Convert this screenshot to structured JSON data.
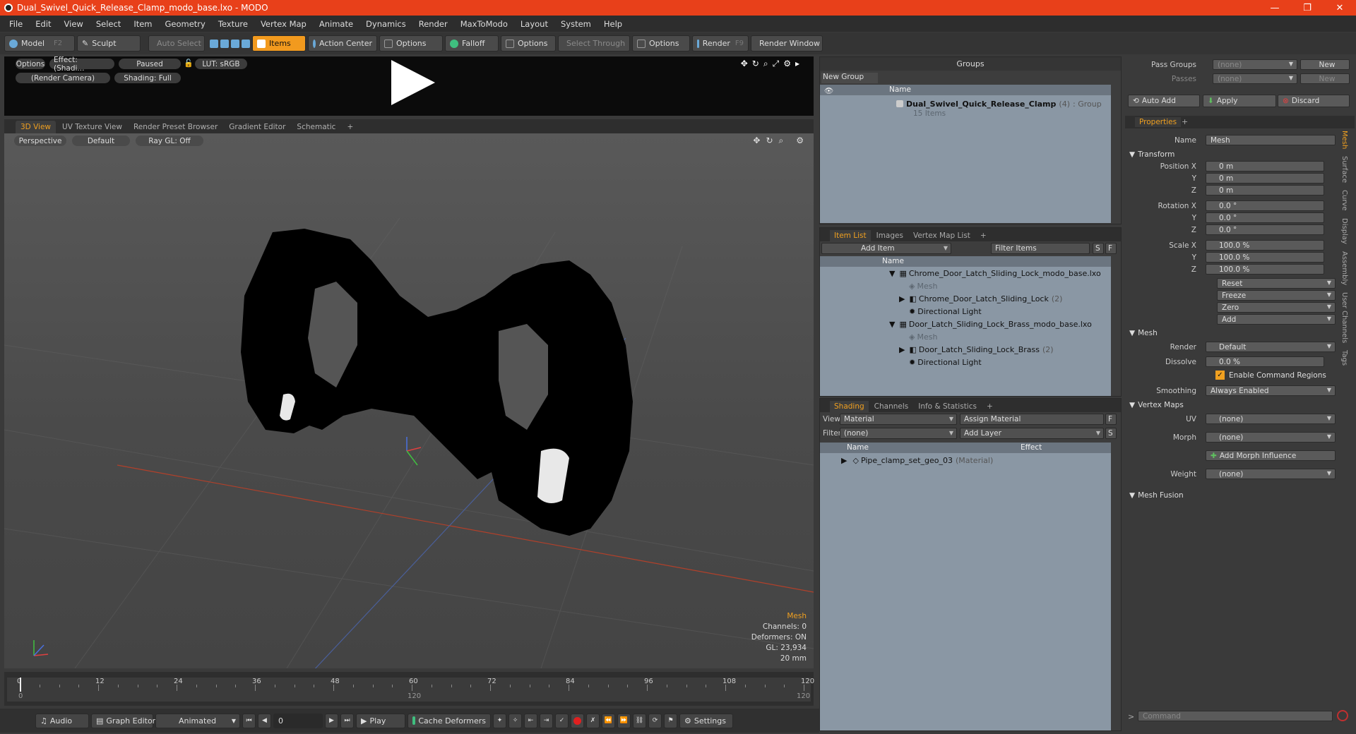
{
  "title": "Dual_Swivel_Quick_Release_Clamp_modo_base.lxo - MODO",
  "window_controls": {
    "minimize": "—",
    "restore": "❐",
    "close": "✕"
  },
  "menu": [
    "File",
    "Edit",
    "View",
    "Select",
    "Item",
    "Geometry",
    "Texture",
    "Vertex Map",
    "Animate",
    "Dynamics",
    "Render",
    "MaxToModo",
    "Layout",
    "System",
    "Help"
  ],
  "toolbar": {
    "model": "Model",
    "model_key": "F2",
    "sculpt": "Sculpt",
    "auto_select": "Auto Select",
    "items": "Items",
    "action_center": "Action Center",
    "options1": "Options",
    "falloff": "Falloff",
    "options2": "Options",
    "select_through": "Select Through",
    "options3": "Options",
    "render": "Render",
    "render_key": "F9",
    "render_window": "Render Window"
  },
  "preview": {
    "options": "Options",
    "effect": "Effect: (Shadi...",
    "paused": "Paused",
    "lut": "LUT: sRGB",
    "camera": "(Render Camera)",
    "shading": "Shading: Full"
  },
  "viewport_tabs": [
    "3D View",
    "UV Texture View",
    "Render Preset Browser",
    "Gradient Editor",
    "Schematic",
    "+"
  ],
  "viewport": {
    "perspective": "Perspective",
    "default": "Default",
    "raygl": "Ray GL: Off",
    "hud_mesh": "Mesh",
    "hud_channels": "Channels: 0",
    "hud_deformers": "Deformers: ON",
    "hud_gl": "GL: 23,934",
    "hud_scale": "20 mm"
  },
  "timeline": {
    "labels": [
      "0",
      "12",
      "24",
      "36",
      "48",
      "60",
      "72",
      "84",
      "96",
      "108",
      "120"
    ],
    "sub_labels": [
      "0",
      "120",
      "120"
    ]
  },
  "bottombar": {
    "audio": "Audio",
    "graph_editor": "Graph Editor",
    "animated": "Animated",
    "frame": "0",
    "play": "Play",
    "cache": "Cache Deformers",
    "settings": "Settings"
  },
  "groups": {
    "header": "Groups",
    "new_group": "New Group",
    "col_name": "Name",
    "item_name": "Dual_Swivel_Quick_Release_Clamp",
    "item_count": "(4)",
    "item_type": ": Group",
    "item_sub": "15 Items"
  },
  "itemlist": {
    "tabs": [
      "Item List",
      "Images",
      "Vertex Map List",
      "+"
    ],
    "add_item": "Add Item",
    "filter": "Filter Items",
    "col_name": "Name",
    "rows": [
      {
        "label": "Chrome_Door_Latch_Sliding_Lock_modo_base.lxo",
        "count": ""
      },
      {
        "label": "Mesh",
        "count": ""
      },
      {
        "label": "Chrome_Door_Latch_Sliding_Lock",
        "count": "(2)"
      },
      {
        "label": "Directional Light",
        "count": ""
      },
      {
        "label": "Door_Latch_Sliding_Lock_Brass_modo_base.lxo",
        "count": ""
      },
      {
        "label": "Mesh",
        "count": ""
      },
      {
        "label": "Door_Latch_Sliding_Lock_Brass",
        "count": "(2)"
      },
      {
        "label": "Directional Light",
        "count": ""
      }
    ]
  },
  "shading": {
    "tabs": [
      "Shading",
      "Channels",
      "Info & Statistics",
      "+"
    ],
    "view_label": "View",
    "view_value": "Material",
    "assign": "Assign Material",
    "filter_label": "Filter",
    "filter_value": "(none)",
    "add_layer": "Add Layer",
    "col_name": "Name",
    "col_effect": "Effect",
    "item": "Pipe_clamp_set_geo_03",
    "item_type": "(Material)"
  },
  "passes": {
    "pass_groups": "Pass Groups",
    "passes": "Passes",
    "none": "(none)",
    "new": "New"
  },
  "actions": {
    "auto_add": "Auto Add",
    "apply": "Apply",
    "discard": "Discard"
  },
  "properties": {
    "tab": "Properties",
    "plus": "+",
    "name_label": "Name",
    "name_value": "Mesh",
    "transform": "Transform",
    "pos_label": "Position X",
    "y": "Y",
    "z": "Z",
    "pos_x": "0 m",
    "pos_y": "0 m",
    "pos_z": "0 m",
    "rot_label": "Rotation X",
    "rot_x": "0.0 °",
    "rot_y": "0.0 °",
    "rot_z": "0.0 °",
    "scale_label": "Scale X",
    "scale_x": "100.0 %",
    "scale_y": "100.0 %",
    "scale_z": "100.0 %",
    "reset": "Reset",
    "freeze": "Freeze",
    "zero": "Zero",
    "add": "Add",
    "mesh_section": "Mesh",
    "render_label": "Render",
    "render_value": "Default",
    "dissolve_label": "Dissolve",
    "dissolve_value": "0.0 %",
    "enable_cmd": "Enable Command Regions",
    "smoothing_label": "Smoothing",
    "smoothing_value": "Always Enabled",
    "vertex_maps": "Vertex Maps",
    "uv_label": "UV",
    "uv_value": "(none)",
    "morph_label": "Morph",
    "morph_value": "(none)",
    "add_morph": "Add Morph Influence",
    "weight_label": "Weight",
    "weight_value": "(none)",
    "mesh_fusion": "Mesh Fusion",
    "command": "Command"
  },
  "side_tabs": [
    "Mesh",
    "Surface",
    "Curve",
    "Display",
    "Assembly",
    "User Channels",
    "Tags"
  ],
  "colors": {
    "title_bar": "#e8401a",
    "accent": "#f0a020",
    "list_bg": "#8a97a4"
  }
}
